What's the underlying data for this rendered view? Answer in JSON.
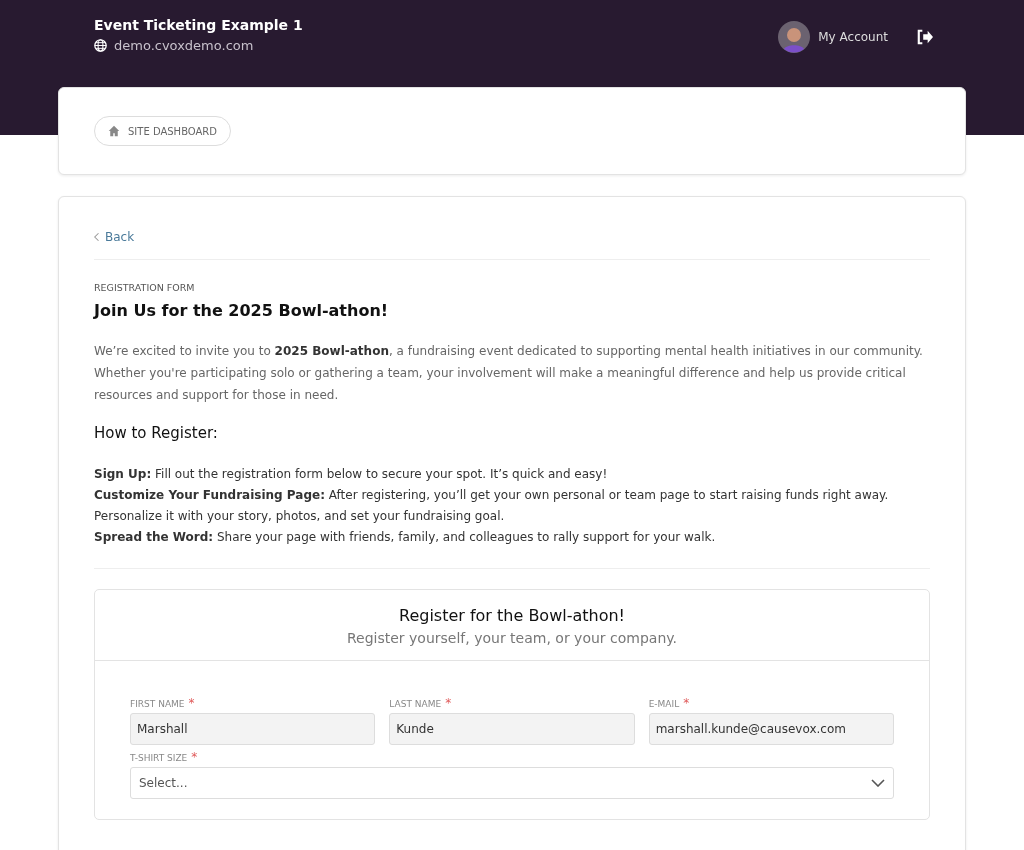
{
  "header": {
    "site_title": "Event Ticketing Example 1",
    "site_url": "demo.cvoxdemo.com",
    "account_label": "My Account"
  },
  "nav": {
    "dashboard_button": "SITE DASHBOARD"
  },
  "page": {
    "back_link": "Back",
    "eyebrow": "REGISTRATION FORM",
    "title": "Join Us for the 2025 Bowl-athon!",
    "intro": "We’re excited to invite you to **2025 Bowl-athon**, a fundraising event dedicated to supporting mental health initiatives in our community. Whether you're participating solo or gathering a team, your involvement will make a meaningful difference and help us provide critical resources and support for those in need.",
    "steps_heading": "How to Register:",
    "steps": [
      {
        "label": "Sign Up:",
        "text": "Fill out the registration form below to secure your spot. It’s quick and easy!"
      },
      {
        "label": "Customize Your Fundraising Page:",
        "text": "After registering, you’ll get your own personal or team page to start raising funds right away. Personalize it with your story, photos, and set your fundraising goal."
      },
      {
        "label": "Spread the Word:",
        "text": "Share your page with friends, family, and colleagues to rally support for your walk."
      }
    ]
  },
  "form": {
    "title": "Register for the Bowl-athon!",
    "subtitle": "Register yourself, your team, or your company.",
    "fields": [
      {
        "kind": "text",
        "label": "FIRST NAME",
        "required_mark": "*",
        "value": "Marshall"
      },
      {
        "kind": "text",
        "label": "LAST NAME",
        "required_mark": "*",
        "value": "Kunde"
      },
      {
        "kind": "text",
        "label": "E-MAIL",
        "required_mark": "*",
        "value": "marshall.kunde@causevox.com"
      },
      {
        "kind": "select",
        "label": "T-SHIRT SIZE",
        "required_mark": "*",
        "placeholder": "Select..."
      }
    ]
  }
}
